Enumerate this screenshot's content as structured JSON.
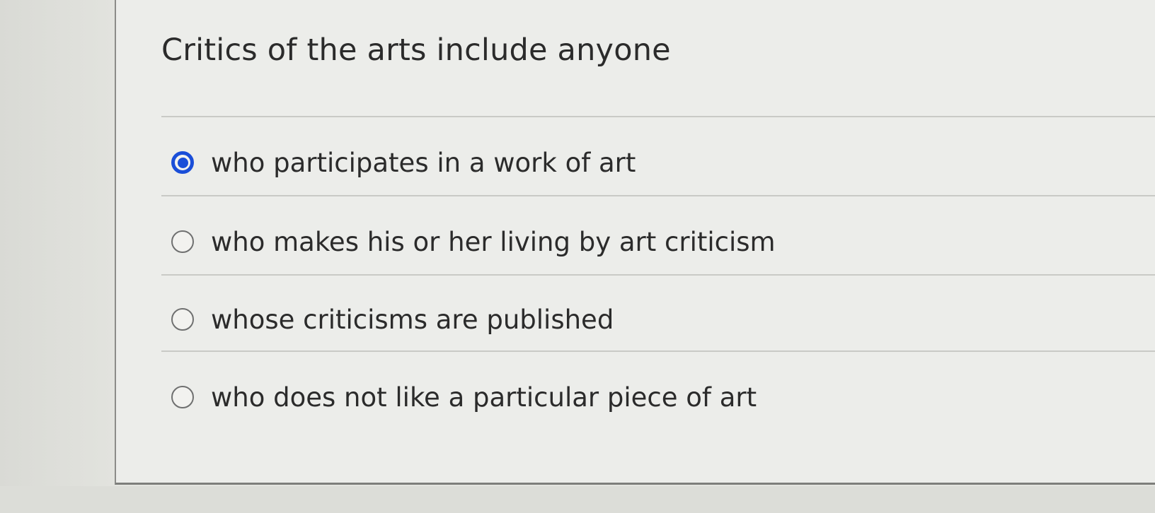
{
  "question": {
    "prompt": "Critics of the arts include anyone"
  },
  "answers": [
    {
      "label": "who participates in a work of art",
      "selected": true
    },
    {
      "label": "who makes his or her living by art criticism",
      "selected": false
    },
    {
      "label": "whose criticisms are published",
      "selected": false
    },
    {
      "label": "who does not like a particular piece of art",
      "selected": false
    }
  ],
  "colors": {
    "selected_radio": "#1a4ed8",
    "text": "#2b2b2b",
    "background": "#ecedea"
  }
}
